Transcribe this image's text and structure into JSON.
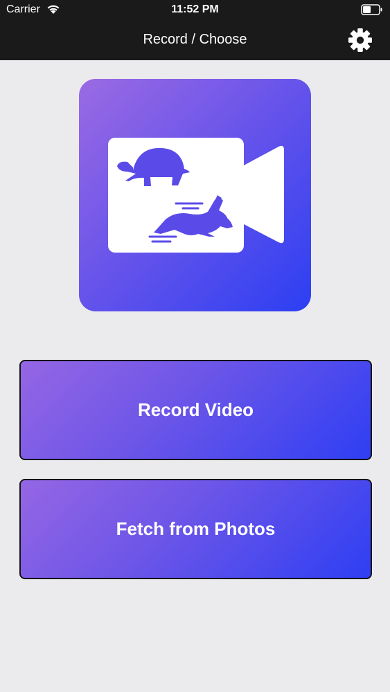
{
  "status_bar": {
    "carrier": "Carrier",
    "time": "11:52 PM",
    "wifi_icon": "wifi-icon",
    "battery_icon": "battery-icon"
  },
  "nav": {
    "title": "Record / Choose",
    "settings_icon": "gear-icon"
  },
  "app_icon": {
    "icon": "video-camera-turtle-rabbit-icon",
    "colors": {
      "gradient_start": "#9b6ae3",
      "gradient_end": "#2c3ff2"
    }
  },
  "buttons": {
    "record_label": "Record Video",
    "fetch_label": "Fetch from Photos"
  },
  "colors": {
    "topbar": "#1a1a1a",
    "background": "#ebebed",
    "button_gradient_start": "#9566e4",
    "button_gradient_end": "#2e3ff3",
    "button_text": "#ffffff"
  }
}
